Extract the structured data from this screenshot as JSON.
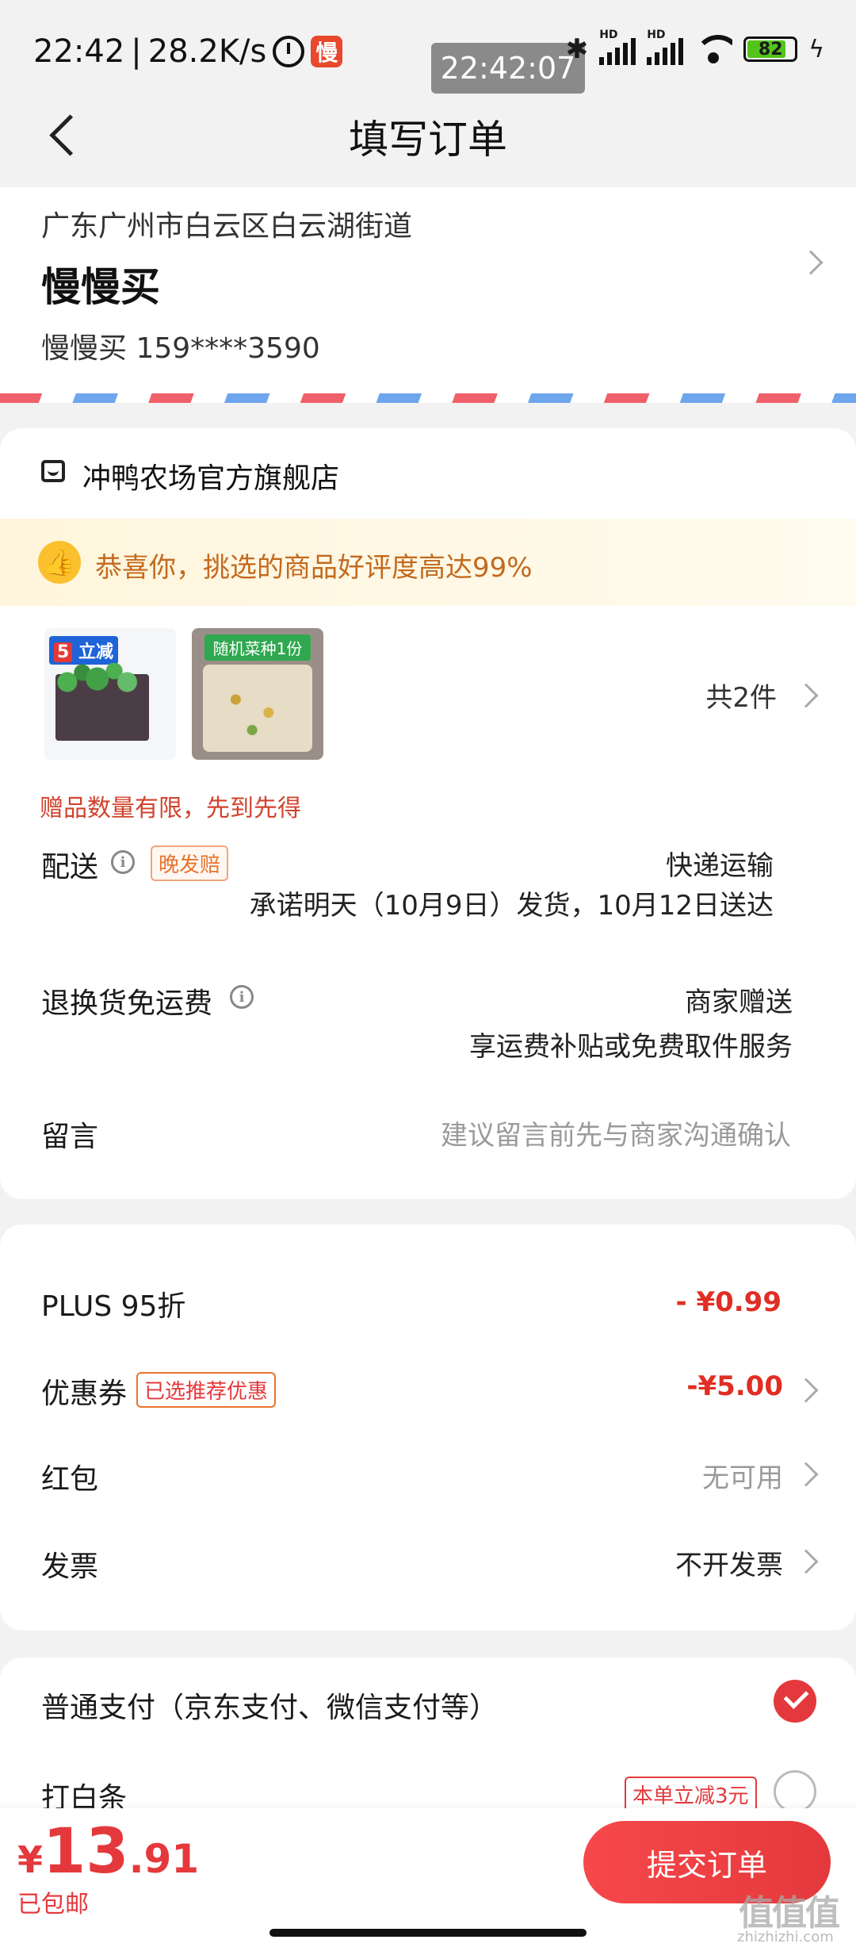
{
  "status": {
    "time": "22:42",
    "net_speed": "28.2K/s",
    "app_badge": "慢",
    "overlay_clock": "22:42:07",
    "battery": "82",
    "hd": "HD"
  },
  "header": {
    "title": "填写订单"
  },
  "address": {
    "line": "广东广州市白云区白云湖街道",
    "name": "慢慢买",
    "contact": "慢慢买  159****3590"
  },
  "shop": {
    "name": "冲鸭农场官方旗舰店"
  },
  "praise": {
    "text": "恭喜你，挑选的商品好评度高达99%"
  },
  "products": {
    "item1_badge": "5",
    "item1_badge_sub": "立减",
    "item2_tag": "随机菜种1份",
    "count": "共2件"
  },
  "gift_note": "赠品数量有限，先到先得",
  "delivery": {
    "label": "配送",
    "tag": "晚发赔",
    "method": "快递运输",
    "promise": "承诺明天（10月9日）发货，10月12日送达"
  },
  "return_shipping": {
    "label": "退换货免运费",
    "value": "商家赠送",
    "desc": "享运费补贴或免费取件服务"
  },
  "message": {
    "label": "留言",
    "placeholder": "建议留言前先与商家沟通确认"
  },
  "pricing": {
    "plus_label": "PLUS 95折",
    "plus_value": "- ¥0.99",
    "coupon_label": "优惠券",
    "coupon_tag": "已选推荐优惠",
    "coupon_value": "-¥5.00",
    "redpacket_label": "红包",
    "redpacket_value": "无可用",
    "invoice_label": "发票",
    "invoice_value": "不开发票"
  },
  "payment": {
    "normal_label": "普通支付（京东支付、微信支付等）",
    "baitiao_label": "打白条",
    "baitiao_promo": "本单立减3元"
  },
  "footer": {
    "currency": "¥",
    "total_int": "13",
    "total_dec": ".91",
    "shipping": "已包邮",
    "submit": "提交订单"
  },
  "watermark": {
    "main": "值值值",
    "sub": "zhizhizhi.com"
  },
  "colors": {
    "accent": "#e4393c",
    "praise": "#c26a1e",
    "gift_note": "#d0432e"
  }
}
